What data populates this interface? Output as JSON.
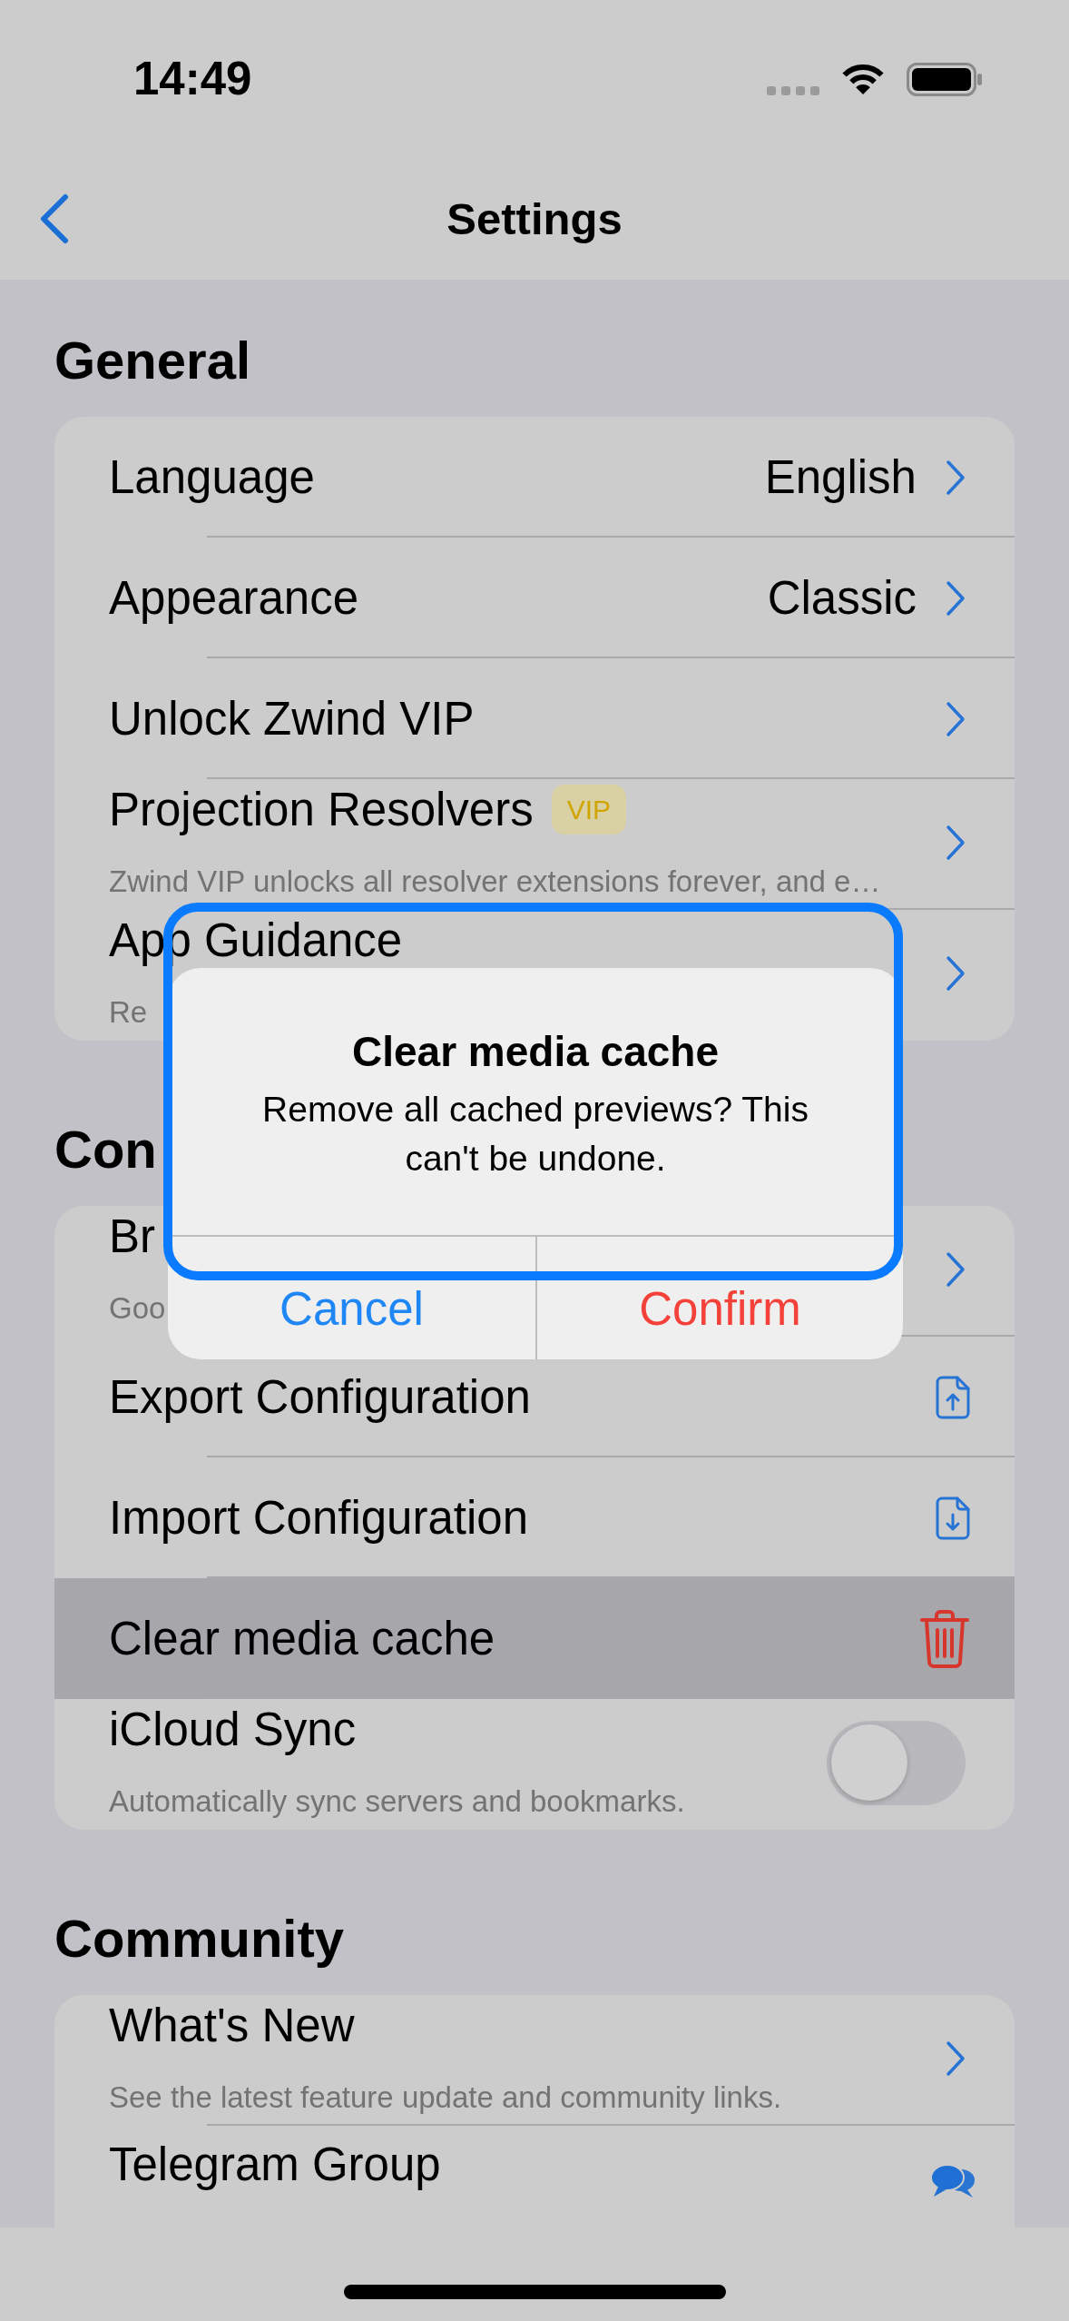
{
  "status_bar": {
    "time": "14:49"
  },
  "nav_bar": {
    "title": "Settings"
  },
  "sections": [
    {
      "title": "General",
      "rows": [
        {
          "kind": "value",
          "label": "Language",
          "value": "English",
          "pressed": false
        },
        {
          "kind": "value",
          "label": "Appearance",
          "value": "Classic",
          "pressed": false
        },
        {
          "kind": "link",
          "label": "Unlock Zwind VIP",
          "pressed": false
        },
        {
          "kind": "link",
          "label": "Projection Resolvers",
          "badge": "VIP",
          "subtitle": "Zwind VIP unlocks all resolver extensions forever, and e…",
          "pressed": false
        },
        {
          "kind": "link",
          "label": "App Guidance",
          "subtitle": "Re",
          "pressed": false
        }
      ]
    },
    {
      "title": "Con",
      "rows": [
        {
          "kind": "link",
          "label": "Br",
          "subtitle": "Goo",
          "pressed": false
        },
        {
          "kind": "export",
          "label": "Export Configuration",
          "pressed": false
        },
        {
          "kind": "import",
          "label": "Import Configuration",
          "pressed": false
        },
        {
          "kind": "delete",
          "label": "Clear media cache",
          "pressed": true
        },
        {
          "kind": "toggle",
          "label": "iCloud Sync",
          "subtitle": "Automatically sync servers and bookmarks.",
          "on": false,
          "pressed": false
        }
      ]
    },
    {
      "title": "Community",
      "rows": [
        {
          "kind": "link",
          "label": "What's New",
          "subtitle": "See the latest feature update and community links.",
          "pressed": false
        },
        {
          "kind": "chat",
          "label": "Telegram Group",
          "pressed": false
        }
      ]
    }
  ],
  "dialog": {
    "title": "Clear media cache",
    "message": "Remove all cached previews? This can't be undone.",
    "buttons": [
      {
        "label": "Cancel",
        "kind": "cancel"
      },
      {
        "label": "Confirm",
        "kind": "destructive"
      }
    ]
  }
}
